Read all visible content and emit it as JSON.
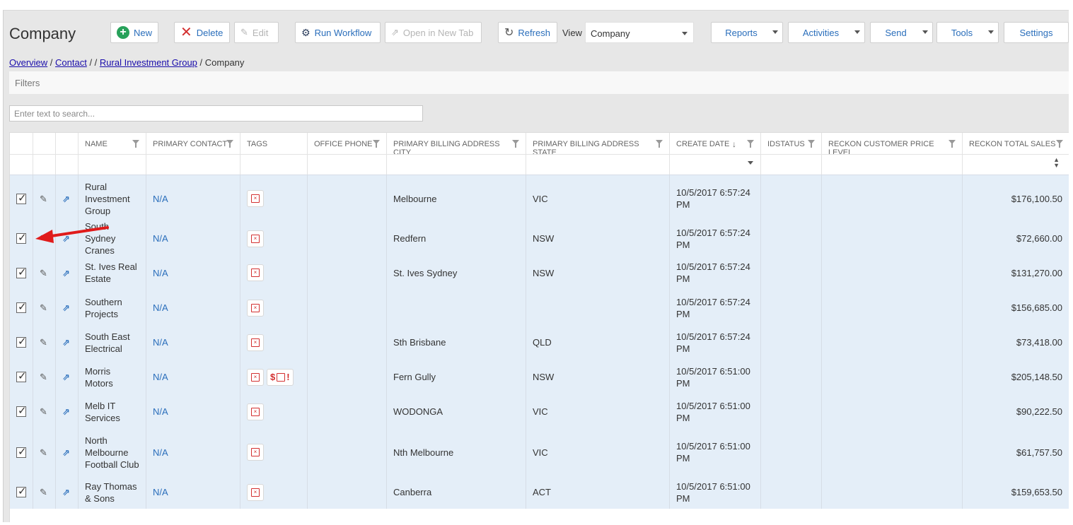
{
  "page": {
    "title": "Company"
  },
  "toolbar": {
    "new_label": "New",
    "delete_label": "Delete",
    "edit_label": "Edit",
    "run_workflow_label": "Run Workflow",
    "open_new_tab_label": "Open in New Tab",
    "refresh_label": "Refresh",
    "view_label": "View",
    "view_value": "Company",
    "reports_label": "Reports",
    "activities_label": "Activities",
    "send_label": "Send",
    "tools_label": "Tools",
    "settings_label": "Settings"
  },
  "breadcrumb": {
    "overview": "Overview",
    "contact": "Contact",
    "sep1": " / ",
    "sep2": " / / ",
    "group": "Rural Investment Group",
    "sep3": " / ",
    "current": "Company"
  },
  "filters": {
    "label": "Filters"
  },
  "search": {
    "placeholder": "Enter text to search..."
  },
  "columns": {
    "name": "NAME",
    "primary_contact": "PRIMARY CONTACT",
    "tags": "TAGS",
    "office_phone": "OFFICE PHONE",
    "billing_city": "PRIMARY BILLING ADDRESS CITY",
    "billing_state": "PRIMARY BILLING ADDRESS STATE",
    "create_date": "CREATE DATE",
    "idstatus": "IDSTATUS",
    "price_level": "RECKON CUSTOMER PRICE LEVEL",
    "total_sales": "RECKON TOTAL SALES"
  },
  "rows": [
    {
      "name": "Rural Investment Group",
      "contact": "N/A",
      "city": "Melbourne",
      "state": "VIC",
      "date": "10/5/2017 6:57:24 PM",
      "sales": "$176,100.50"
    },
    {
      "name": "South Sydney Cranes",
      "contact": "N/A",
      "city": "Redfern",
      "state": "NSW",
      "date": "10/5/2017 6:57:24 PM",
      "sales": "$72,660.00"
    },
    {
      "name": "St. Ives Real Estate",
      "contact": "N/A",
      "city": "St. Ives Sydney",
      "state": "NSW",
      "date": "10/5/2017 6:57:24 PM",
      "sales": "$131,270.00"
    },
    {
      "name": "Southern Projects",
      "contact": "N/A",
      "city": "",
      "state": "",
      "date": "10/5/2017 6:57:24 PM",
      "sales": "$156,685.00"
    },
    {
      "name": "South East Electrical",
      "contact": "N/A",
      "city": "Sth Brisbane",
      "state": "QLD",
      "date": "10/5/2017 6:57:24 PM",
      "sales": "$73,418.00"
    },
    {
      "name": "Morris Motors",
      "contact": "N/A",
      "city": "Fern Gully",
      "state": "NSW",
      "date": "10/5/2017 6:51:00 PM",
      "sales": "$205,148.50"
    },
    {
      "name": "Melb IT Services",
      "contact": "N/A",
      "city": "WODONGA",
      "state": "VIC",
      "date": "10/5/2017 6:51:00 PM",
      "sales": "$90,222.50"
    },
    {
      "name": "North Melbourne Football Club",
      "contact": "N/A",
      "city": "Nth Melbourne",
      "state": "VIC",
      "date": "10/5/2017 6:51:00 PM",
      "sales": "$61,757.50"
    },
    {
      "name": "Ray Thomas & Sons",
      "contact": "N/A",
      "city": "Canberra",
      "state": "ACT",
      "date": "10/5/2017 6:51:00 PM",
      "sales": "$159,653.50"
    }
  ],
  "colors": {
    "accent": "#2a6ebb",
    "row_bg": "#e4eef8",
    "annotation": "#e01b1b",
    "tag_red": "#d32f2f"
  }
}
